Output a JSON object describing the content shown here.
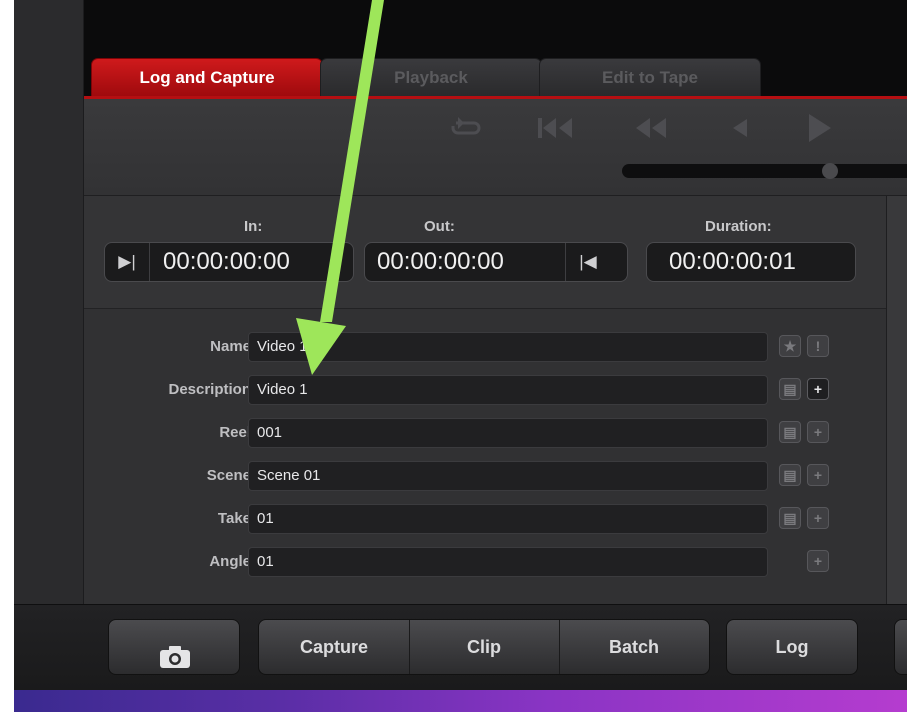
{
  "tabs": [
    {
      "label": "Log and Capture",
      "active": true
    },
    {
      "label": "Playback",
      "active": false
    },
    {
      "label": "Edit to Tape",
      "active": false
    }
  ],
  "transport": {
    "icons": [
      "loop-icon",
      "skip-to-start-icon",
      "rewind-icon",
      "step-back-icon",
      "play-icon"
    ]
  },
  "timecodes": {
    "in_label": "In:",
    "in_value": "00:00:00:00",
    "out_label": "Out:",
    "out_value": "00:00:00:00",
    "duration_label": "Duration:",
    "duration_value": "00:00:00:01"
  },
  "fields": [
    {
      "label": "Name:",
      "value": "Video 1"
    },
    {
      "label": "Description:",
      "value": "Video 1"
    },
    {
      "label": "Reel:",
      "value": "001"
    },
    {
      "label": "Scene:",
      "value": "Scene 01"
    },
    {
      "label": "Take:",
      "value": "01"
    },
    {
      "label": "Angle:",
      "value": "01"
    }
  ],
  "bottom": {
    "camera_icon": "camera-icon",
    "capture_label": "Capture",
    "clip_label": "Clip",
    "batch_label": "Batch",
    "log_label": "Log"
  },
  "colors": {
    "accent": "#b50f12",
    "annotation_arrow": "#9ee65a"
  }
}
